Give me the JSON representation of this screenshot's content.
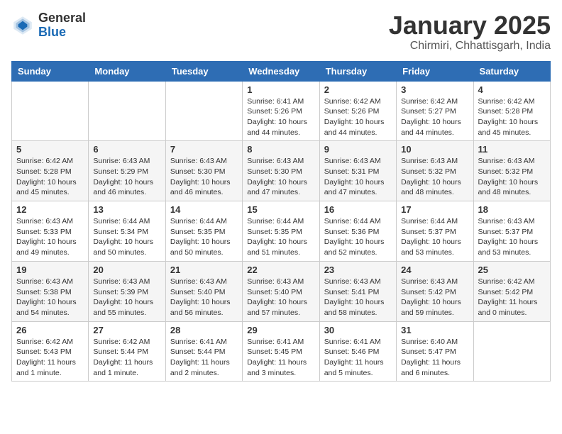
{
  "logo": {
    "general": "General",
    "blue": "Blue"
  },
  "title": "January 2025",
  "subtitle": "Chirmiri, Chhattisgarh, India",
  "days_of_week": [
    "Sunday",
    "Monday",
    "Tuesday",
    "Wednesday",
    "Thursday",
    "Friday",
    "Saturday"
  ],
  "weeks": [
    [
      {
        "day": "",
        "info": ""
      },
      {
        "day": "",
        "info": ""
      },
      {
        "day": "",
        "info": ""
      },
      {
        "day": "1",
        "info": "Sunrise: 6:41 AM\nSunset: 5:26 PM\nDaylight: 10 hours\nand 44 minutes."
      },
      {
        "day": "2",
        "info": "Sunrise: 6:42 AM\nSunset: 5:26 PM\nDaylight: 10 hours\nand 44 minutes."
      },
      {
        "day": "3",
        "info": "Sunrise: 6:42 AM\nSunset: 5:27 PM\nDaylight: 10 hours\nand 44 minutes."
      },
      {
        "day": "4",
        "info": "Sunrise: 6:42 AM\nSunset: 5:28 PM\nDaylight: 10 hours\nand 45 minutes."
      }
    ],
    [
      {
        "day": "5",
        "info": "Sunrise: 6:42 AM\nSunset: 5:28 PM\nDaylight: 10 hours\nand 45 minutes."
      },
      {
        "day": "6",
        "info": "Sunrise: 6:43 AM\nSunset: 5:29 PM\nDaylight: 10 hours\nand 46 minutes."
      },
      {
        "day": "7",
        "info": "Sunrise: 6:43 AM\nSunset: 5:30 PM\nDaylight: 10 hours\nand 46 minutes."
      },
      {
        "day": "8",
        "info": "Sunrise: 6:43 AM\nSunset: 5:30 PM\nDaylight: 10 hours\nand 47 minutes."
      },
      {
        "day": "9",
        "info": "Sunrise: 6:43 AM\nSunset: 5:31 PM\nDaylight: 10 hours\nand 47 minutes."
      },
      {
        "day": "10",
        "info": "Sunrise: 6:43 AM\nSunset: 5:32 PM\nDaylight: 10 hours\nand 48 minutes."
      },
      {
        "day": "11",
        "info": "Sunrise: 6:43 AM\nSunset: 5:32 PM\nDaylight: 10 hours\nand 48 minutes."
      }
    ],
    [
      {
        "day": "12",
        "info": "Sunrise: 6:43 AM\nSunset: 5:33 PM\nDaylight: 10 hours\nand 49 minutes."
      },
      {
        "day": "13",
        "info": "Sunrise: 6:44 AM\nSunset: 5:34 PM\nDaylight: 10 hours\nand 50 minutes."
      },
      {
        "day": "14",
        "info": "Sunrise: 6:44 AM\nSunset: 5:35 PM\nDaylight: 10 hours\nand 50 minutes."
      },
      {
        "day": "15",
        "info": "Sunrise: 6:44 AM\nSunset: 5:35 PM\nDaylight: 10 hours\nand 51 minutes."
      },
      {
        "day": "16",
        "info": "Sunrise: 6:44 AM\nSunset: 5:36 PM\nDaylight: 10 hours\nand 52 minutes."
      },
      {
        "day": "17",
        "info": "Sunrise: 6:44 AM\nSunset: 5:37 PM\nDaylight: 10 hours\nand 53 minutes."
      },
      {
        "day": "18",
        "info": "Sunrise: 6:43 AM\nSunset: 5:37 PM\nDaylight: 10 hours\nand 53 minutes."
      }
    ],
    [
      {
        "day": "19",
        "info": "Sunrise: 6:43 AM\nSunset: 5:38 PM\nDaylight: 10 hours\nand 54 minutes."
      },
      {
        "day": "20",
        "info": "Sunrise: 6:43 AM\nSunset: 5:39 PM\nDaylight: 10 hours\nand 55 minutes."
      },
      {
        "day": "21",
        "info": "Sunrise: 6:43 AM\nSunset: 5:40 PM\nDaylight: 10 hours\nand 56 minutes."
      },
      {
        "day": "22",
        "info": "Sunrise: 6:43 AM\nSunset: 5:40 PM\nDaylight: 10 hours\nand 57 minutes."
      },
      {
        "day": "23",
        "info": "Sunrise: 6:43 AM\nSunset: 5:41 PM\nDaylight: 10 hours\nand 58 minutes."
      },
      {
        "day": "24",
        "info": "Sunrise: 6:43 AM\nSunset: 5:42 PM\nDaylight: 10 hours\nand 59 minutes."
      },
      {
        "day": "25",
        "info": "Sunrise: 6:42 AM\nSunset: 5:42 PM\nDaylight: 11 hours\nand 0 minutes."
      }
    ],
    [
      {
        "day": "26",
        "info": "Sunrise: 6:42 AM\nSunset: 5:43 PM\nDaylight: 11 hours\nand 1 minute."
      },
      {
        "day": "27",
        "info": "Sunrise: 6:42 AM\nSunset: 5:44 PM\nDaylight: 11 hours\nand 1 minute."
      },
      {
        "day": "28",
        "info": "Sunrise: 6:41 AM\nSunset: 5:44 PM\nDaylight: 11 hours\nand 2 minutes."
      },
      {
        "day": "29",
        "info": "Sunrise: 6:41 AM\nSunset: 5:45 PM\nDaylight: 11 hours\nand 3 minutes."
      },
      {
        "day": "30",
        "info": "Sunrise: 6:41 AM\nSunset: 5:46 PM\nDaylight: 11 hours\nand 5 minutes."
      },
      {
        "day": "31",
        "info": "Sunrise: 6:40 AM\nSunset: 5:47 PM\nDaylight: 11 hours\nand 6 minutes."
      },
      {
        "day": "",
        "info": ""
      }
    ]
  ]
}
